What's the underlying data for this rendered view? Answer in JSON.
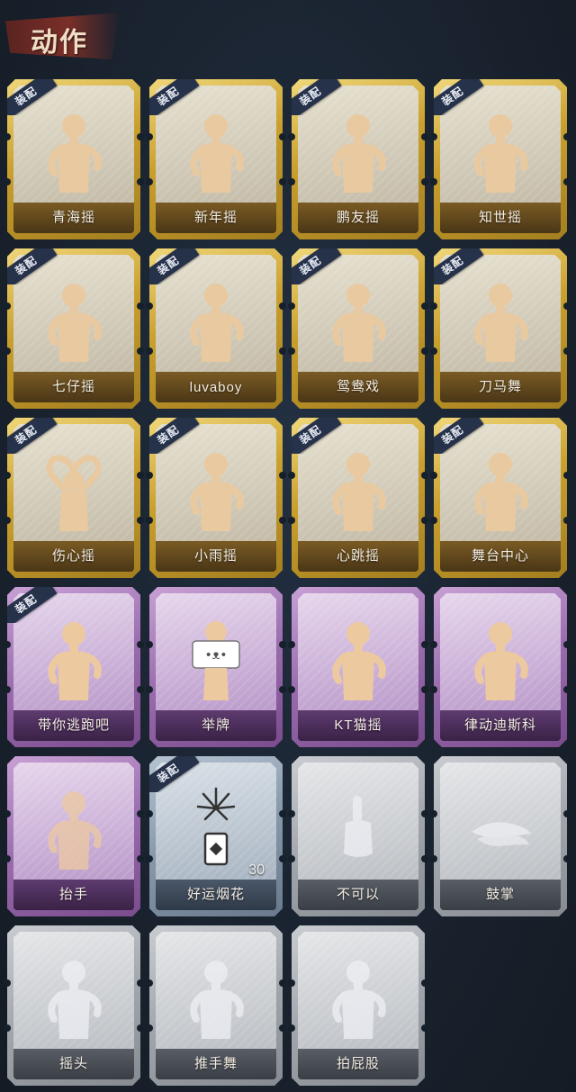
{
  "header": {
    "title": "动作"
  },
  "equip_label": "装配",
  "cards": [
    {
      "label": "青海摇",
      "tier": "gold",
      "equipped": true,
      "icon": "dance-figure-icon"
    },
    {
      "label": "新年摇",
      "tier": "gold",
      "equipped": true,
      "icon": "dance-figure-icon"
    },
    {
      "label": "鹏友摇",
      "tier": "gold",
      "equipped": true,
      "icon": "dance-figure-icon"
    },
    {
      "label": "知世摇",
      "tier": "gold",
      "equipped": true,
      "icon": "dance-figure-icon"
    },
    {
      "label": "七仔摇",
      "tier": "gold",
      "equipped": true,
      "icon": "dance-figure-icon"
    },
    {
      "label": "luvaboy",
      "tier": "gold",
      "equipped": true,
      "icon": "dance-figure-icon"
    },
    {
      "label": "鸳鸯戏",
      "tier": "gold",
      "equipped": true,
      "icon": "dance-figure-icon"
    },
    {
      "label": "刀马舞",
      "tier": "gold",
      "equipped": true,
      "icon": "dance-figure-icon"
    },
    {
      "label": "伤心摇",
      "tier": "gold",
      "equipped": true,
      "icon": "heart-hands-figure-icon"
    },
    {
      "label": "小雨摇",
      "tier": "gold",
      "equipped": true,
      "icon": "dance-figure-icon"
    },
    {
      "label": "心跳摇",
      "tier": "gold",
      "equipped": true,
      "icon": "dance-figure-icon"
    },
    {
      "label": "舞台中心",
      "tier": "gold",
      "equipped": true,
      "icon": "dance-figure-icon"
    },
    {
      "label": "带你逃跑吧",
      "tier": "purple",
      "equipped": true,
      "icon": "dance-figure-icon"
    },
    {
      "label": "举牌",
      "tier": "purple",
      "equipped": false,
      "icon": "sign-holding-figure-icon"
    },
    {
      "label": "KT猫摇",
      "tier": "purple",
      "equipped": false,
      "icon": "dance-figure-icon"
    },
    {
      "label": "律动迪斯科",
      "tier": "purple",
      "equipped": false,
      "icon": "disco-figure-icon"
    },
    {
      "label": "抬手",
      "tier": "purple",
      "equipped": false,
      "icon": "raise-hand-figure-icon"
    },
    {
      "label": "好运烟花",
      "tier": "blue",
      "equipped": true,
      "icon": "firework-icon",
      "count": "30"
    },
    {
      "label": "不可以",
      "tier": "grey",
      "equipped": false,
      "icon": "wagging-finger-icon"
    },
    {
      "label": "鼓掌",
      "tier": "grey",
      "equipped": false,
      "icon": "clapping-hands-icon"
    },
    {
      "label": "摇头",
      "tier": "grey",
      "equipped": false,
      "icon": "shake-head-figure-icon"
    },
    {
      "label": "推手舞",
      "tier": "grey",
      "equipped": false,
      "icon": "push-hand-figure-icon"
    },
    {
      "label": "拍屁股",
      "tier": "grey",
      "equipped": false,
      "icon": "pat-figure-icon"
    }
  ]
}
